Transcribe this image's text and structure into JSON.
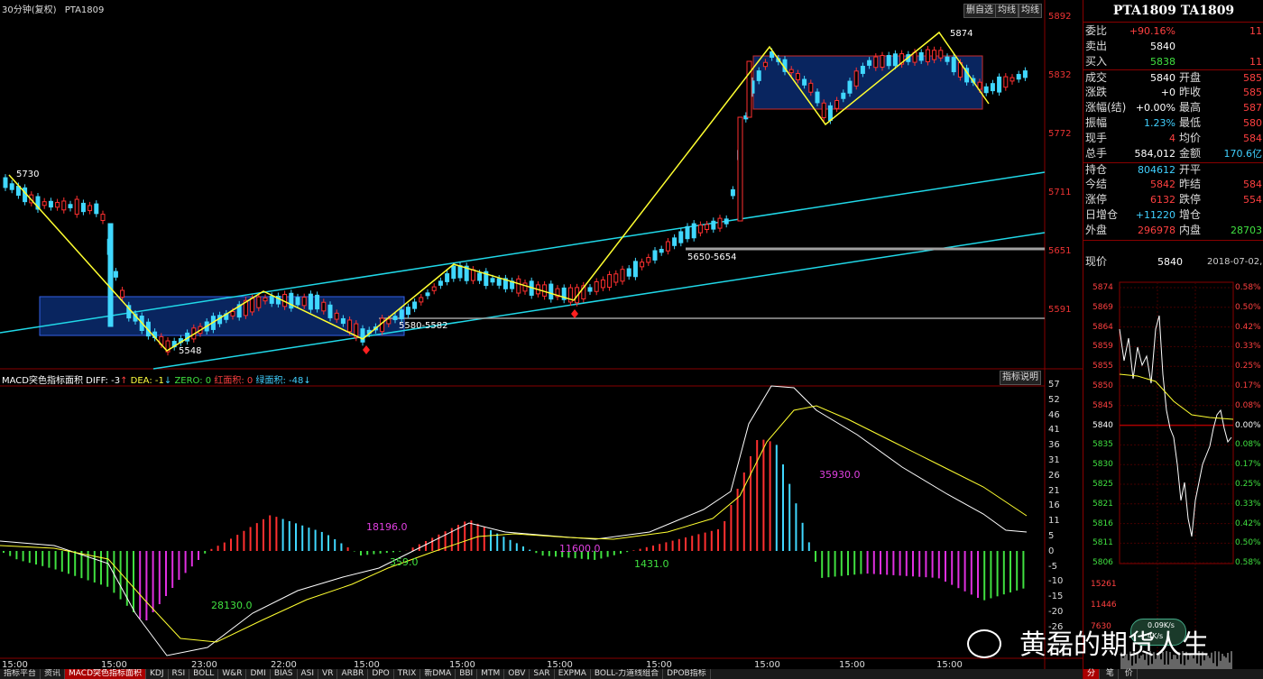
{
  "header": {
    "title": "30分钟(复权)",
    "symbol": "PTA1809",
    "btn_delete": "删自选",
    "btn_ma": "均线",
    "btn_draw": "均线"
  },
  "price_axis": [
    "5892",
    "5832",
    "5772",
    "5711",
    "5651",
    "5591"
  ],
  "annotations": {
    "a5730": "5730",
    "a5548": "5548",
    "a5874": "5874",
    "a5580": "5580-5582",
    "a5650": "5650-5654"
  },
  "macd_header": {
    "name": "MACD突色指标面积",
    "diff": "DIFF: -3",
    "dea": "DEA: -1",
    "zero": "ZERO: 0",
    "red_area": "红面积: 0",
    "green_area": "绿面积: -48",
    "help_btn": "指标说明"
  },
  "macd_axis": [
    "57",
    "52",
    "46",
    "41",
    "36",
    "31",
    "26",
    "21",
    "16",
    "11",
    "5",
    "0",
    "-5",
    "-10",
    "-15",
    "-20",
    "-26"
  ],
  "macd_annotations": {
    "m1": "18196.0",
    "m2": "359.0",
    "m3": "11600.0",
    "m4": "1431.0",
    "m5": "28130.0",
    "m6": "35930.0"
  },
  "time_axis": [
    "15:00",
    "15:00",
    "23:00",
    "22:00",
    "15:00",
    "15:00",
    "15:00",
    "15:00",
    "15:00",
    "15:00",
    "15:00"
  ],
  "tabs": [
    "指标平台",
    "资讯",
    "MACD突色指标面积",
    "KDJ",
    "RSI",
    "BOLL",
    "W&R",
    "DMI",
    "BIAS",
    "ASI",
    "VR",
    "ARBR",
    "DPO",
    "TRIX",
    "新DMA",
    "BBI",
    "MTM",
    "OBV",
    "SAR",
    "EXPMA",
    "BOLL-力道线组合",
    "DPOB指标"
  ],
  "quote": {
    "title": "PTA1809 TA1809",
    "rows": [
      {
        "label": "委比",
        "value": "+90.16%",
        "color": "red",
        "extra": "11"
      },
      {
        "label": "卖出",
        "value": "5840",
        "color": "white",
        "extra": ""
      },
      {
        "label": "买入",
        "value": "5838",
        "color": "green",
        "extra": "11"
      },
      {
        "label": "成交",
        "value": "5840",
        "color": "white",
        "label2": "开盘",
        "value2": "585"
      },
      {
        "label": "涨跌",
        "value": "+0",
        "color": "white",
        "label2": "昨收",
        "value2": "585"
      },
      {
        "label": "涨幅(结)",
        "value": "+0.00%",
        "color": "white",
        "label2": "最高",
        "value2": "587"
      },
      {
        "label": "振幅",
        "value": "1.23%",
        "color": "cyan",
        "label2": "最低",
        "value2": "580"
      },
      {
        "label": "现手",
        "value": "4",
        "color": "red",
        "label2": "均价",
        "value2": "584"
      },
      {
        "label": "总手",
        "value": "584,012",
        "color": "white",
        "label2": "金额",
        "value2": "170.6亿"
      },
      {
        "label": "持仓",
        "value": "804612",
        "color": "cyan",
        "label2": "开平",
        "value2": ""
      },
      {
        "label": "今结",
        "value": "5842",
        "color": "red",
        "label2": "昨结",
        "value2": "584"
      },
      {
        "label": "涨停",
        "value": "6132",
        "color": "red",
        "label2": "跌停",
        "value2": "554"
      },
      {
        "label": "日增仓",
        "value": "+11220",
        "color": "cyan",
        "label2": "增仓",
        "value2": ""
      },
      {
        "label": "外盘",
        "value": "296978",
        "color": "red",
        "label2": "内盘",
        "value2": "28703"
      }
    ],
    "now_label": "现价",
    "now_value": "5840",
    "date": "2018-07-02,"
  },
  "mini_axis_left": [
    "5874",
    "5869",
    "5864",
    "5859",
    "5855",
    "5850",
    "5845",
    "5840",
    "5835",
    "5830",
    "5825",
    "5821",
    "5816",
    "5811",
    "5806"
  ],
  "mini_axis_right": [
    "0.58%",
    "0.50%",
    "0.42%",
    "0.33%",
    "0.25%",
    "0.17%",
    "0.08%",
    "0.00%",
    "0.08%",
    "0.17%",
    "0.25%",
    "0.33%",
    "0.42%",
    "0.50%",
    "0.58%"
  ],
  "mini_vol": [
    "15261",
    "11446",
    "7630"
  ],
  "mini_speed": {
    "up": "0.09K/s",
    "down": "4K/s"
  },
  "mini_tabs": [
    "分",
    "笔",
    "价"
  ],
  "watermark": "黄磊的期货人生"
}
